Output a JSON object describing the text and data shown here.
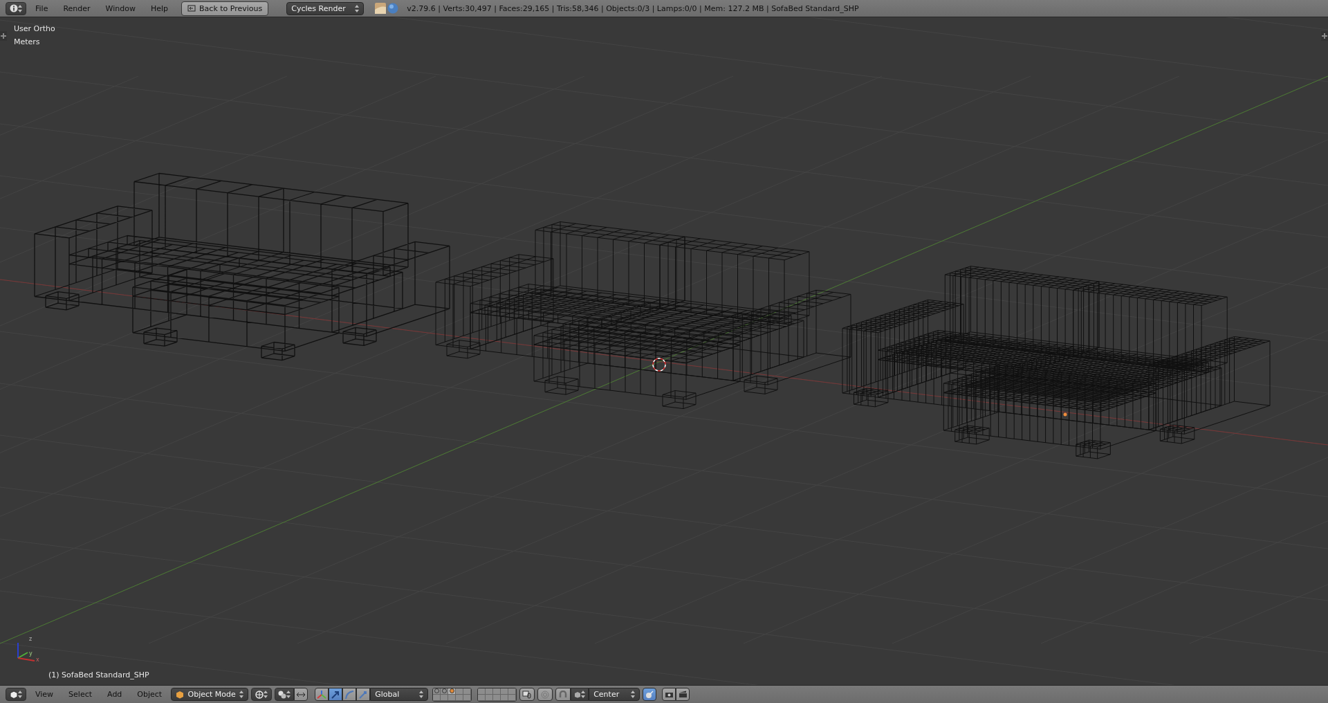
{
  "top_bar": {
    "menus": [
      {
        "label": "File"
      },
      {
        "label": "Render"
      },
      {
        "label": "Window"
      },
      {
        "label": "Help"
      }
    ],
    "back_button": "Back to Previous",
    "render_engine": "Cycles Render",
    "stats": "v2.79.6 | Verts:30,497 | Faces:29,165 | Tris:58,346 | Objects:0/3 | Lamps:0/0 | Mem: 127.2 MB | SofaBed Standard_SHP"
  },
  "viewport": {
    "view_name": "User Ortho",
    "units": "Meters",
    "object_label": "(1) SofaBed Standard_SHP",
    "gizmo_axes": [
      "x",
      "y",
      "z"
    ]
  },
  "bottom_bar": {
    "menus": [
      {
        "label": "View"
      },
      {
        "label": "Select"
      },
      {
        "label": "Add"
      },
      {
        "label": "Object"
      }
    ],
    "mode": "Object Mode",
    "orientation": "Global",
    "pivot": "Center",
    "manipulators": [
      {
        "selected": false
      },
      {
        "selected": true
      },
      {
        "selected": false
      },
      {
        "selected": false
      }
    ],
    "layers": [
      {
        "has_objects": true,
        "selected": false
      },
      {
        "has_objects": true,
        "selected": false
      },
      {
        "has_objects": true,
        "selected": true
      },
      {
        "has_objects": false,
        "selected": false
      },
      {
        "has_objects": false,
        "selected": false
      },
      {
        "has_objects": false,
        "selected": false
      },
      {
        "has_objects": false,
        "selected": false
      },
      {
        "has_objects": false,
        "selected": false
      },
      {
        "has_objects": false,
        "selected": false
      },
      {
        "has_objects": false,
        "selected": false
      },
      {
        "has_objects": false,
        "selected": false
      },
      {
        "has_objects": false,
        "selected": false
      },
      {
        "has_objects": false,
        "selected": false
      },
      {
        "has_objects": false,
        "selected": false
      },
      {
        "has_objects": false,
        "selected": false
      },
      {
        "has_objects": false,
        "selected": false
      },
      {
        "has_objects": false,
        "selected": false
      },
      {
        "has_objects": false,
        "selected": false
      },
      {
        "has_objects": false,
        "selected": false
      },
      {
        "has_objects": false,
        "selected": false
      }
    ]
  }
}
